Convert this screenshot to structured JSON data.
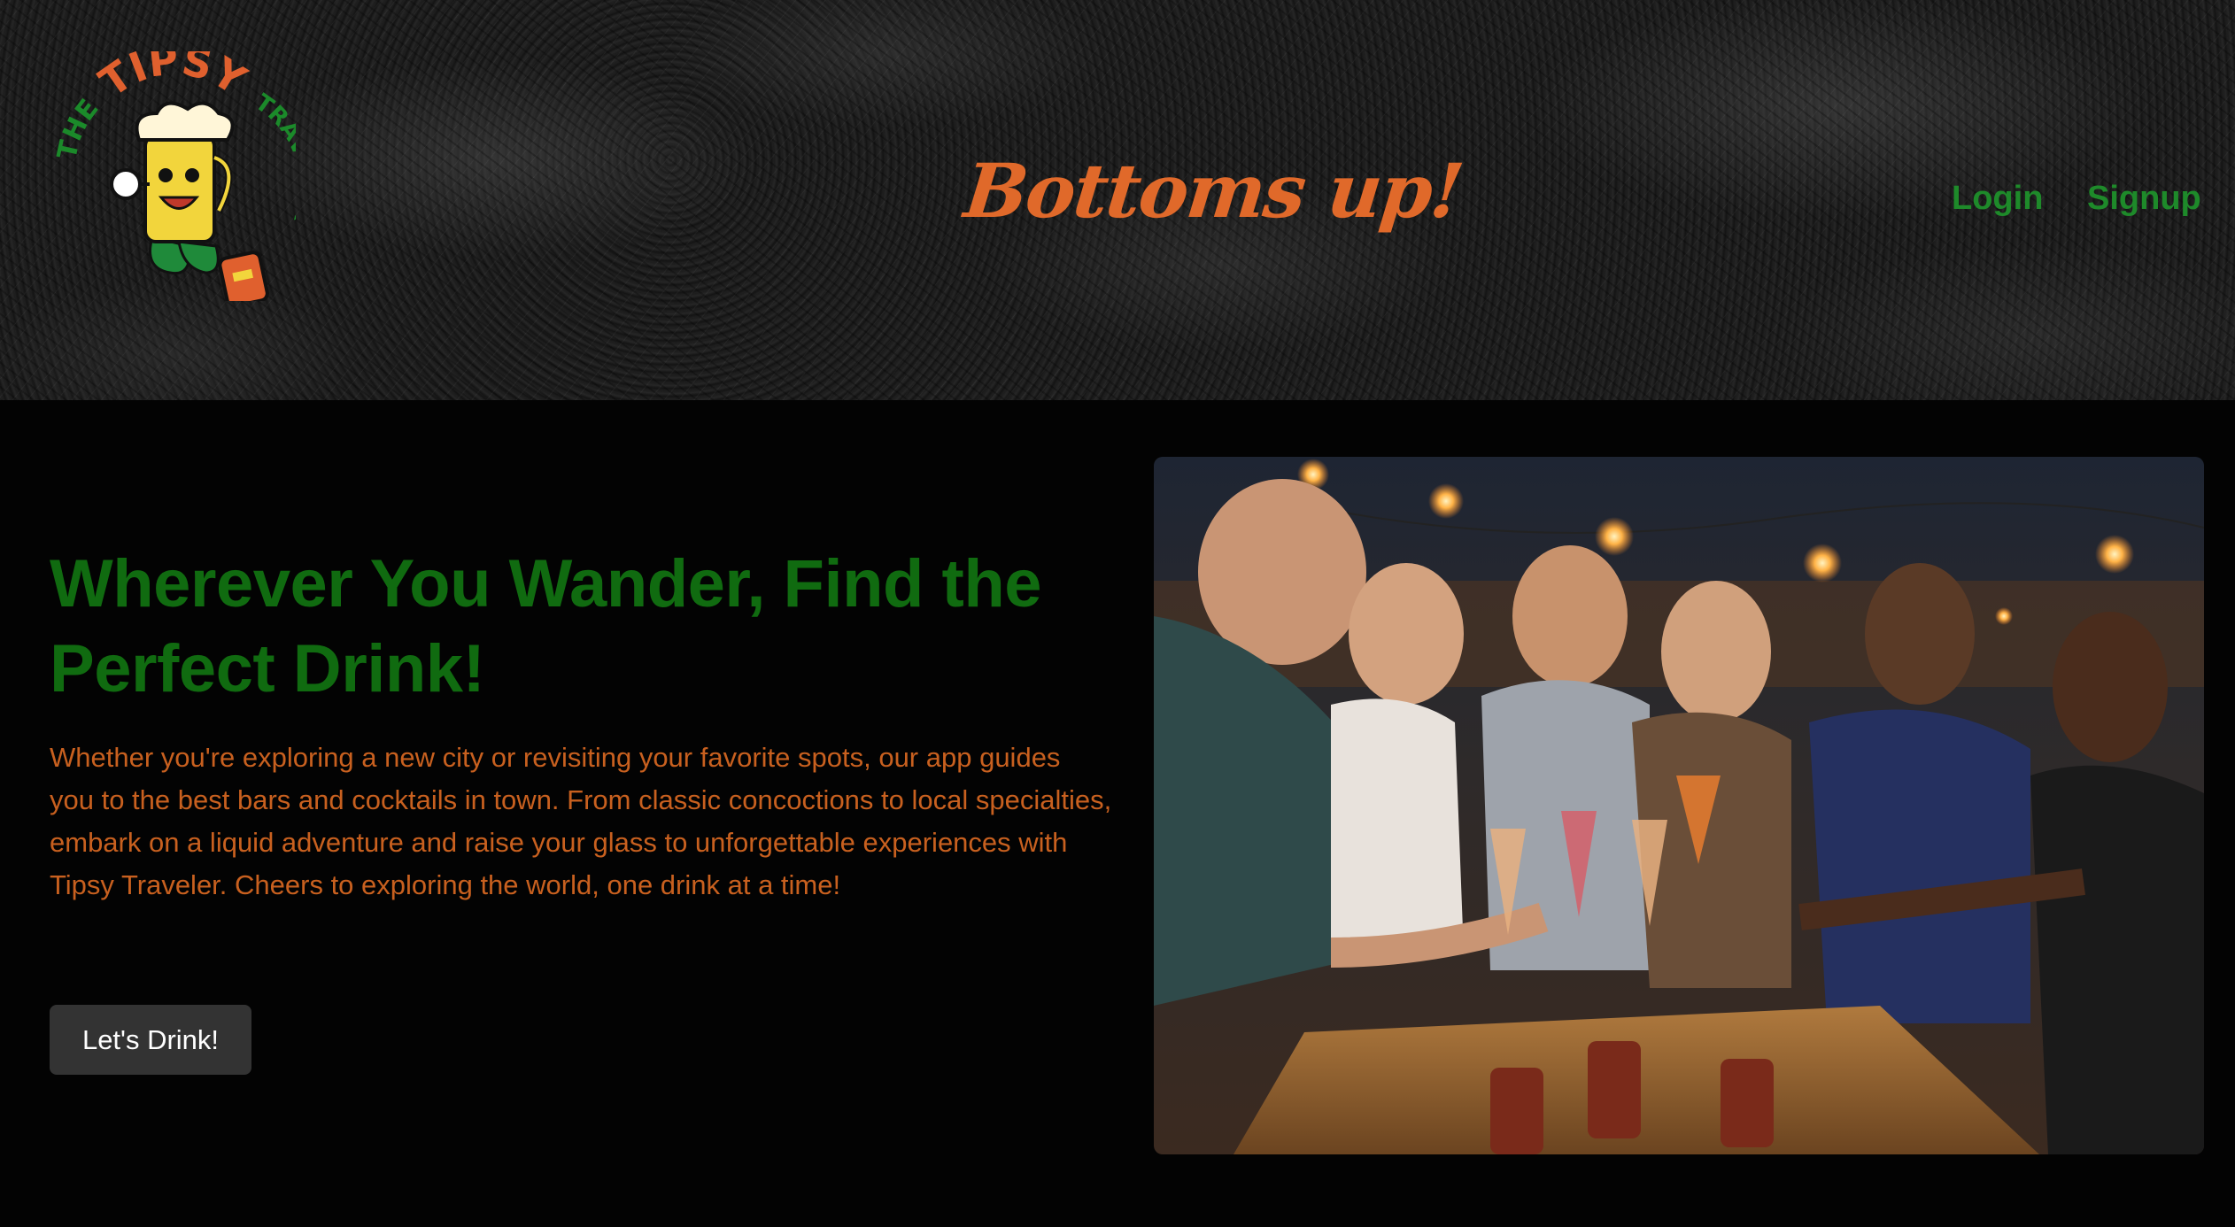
{
  "header": {
    "logo": {
      "top_text": "TIPSY",
      "left_text": "THE",
      "right_text": "TRAVELER"
    },
    "tagline": "Bottoms up!",
    "nav": {
      "login_label": "Login",
      "signup_label": "Signup"
    }
  },
  "hero": {
    "title": "Wherever You Wander, Find the Perfect Drink!",
    "body": "Whether you're exploring a new city or revisiting your favorite spots, our app guides you to the best bars and cocktails in town. From classic concoctions to local specialties, embark on a liquid adventure and raise your glass to unforgettable experiences with Tipsy Traveler. Cheers to exploring the world, one drink at a time!",
    "cta_label": "Let's Drink!"
  },
  "colors": {
    "accent_orange": "#e0692a",
    "brand_green": "#1e8a2a",
    "title_green": "#106b10",
    "body_orange": "#c8601f",
    "button_bg": "#333333",
    "page_bg": "#030303"
  }
}
